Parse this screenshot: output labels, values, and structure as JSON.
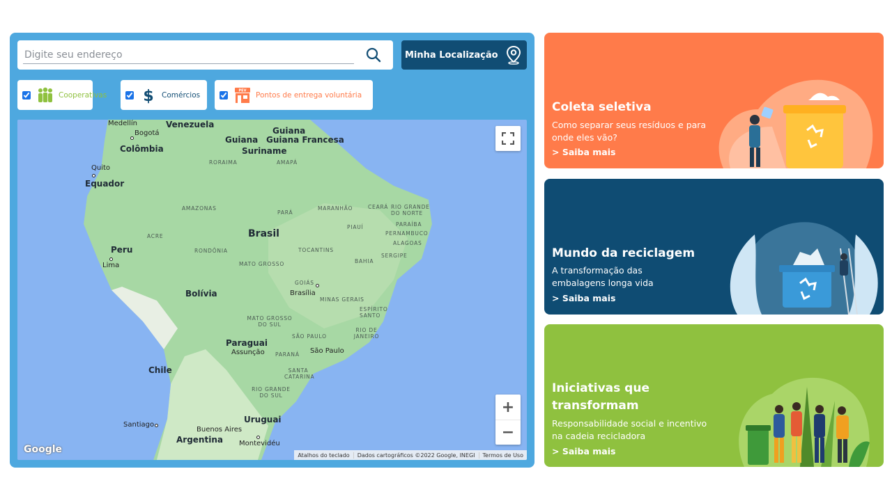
{
  "search": {
    "placeholder": "Digite seu endereço"
  },
  "location_button": {
    "label": "Minha Localização"
  },
  "filters": [
    {
      "label": "Cooperativas",
      "checked": true,
      "color": "#8fc13f"
    },
    {
      "label": "Comércios",
      "checked": true,
      "color": "#114d74"
    },
    {
      "label": "Pontos de entrega voluntária",
      "checked": true,
      "color": "#ff7b4a",
      "badge": "PEV"
    }
  ],
  "map": {
    "labels": {
      "medellin": "Medellín",
      "venezuela": "Venezuela",
      "bogota": "Bogotá",
      "colombia": "Colômbia",
      "guiana": "Guiana",
      "guiana_francesa": "Guiana Francesa",
      "suriname": "Suriname",
      "roraima": "RORAIMA",
      "amapa": "AMAPÁ",
      "quito": "Quito",
      "equador": "Equador",
      "amazonas": "AMAZONAS",
      "para": "PARÁ",
      "maranhao": "MARANHÃO",
      "ceara": "CEARÁ",
      "rio_grande_norte": "RIO GRANDE DO NORTE",
      "piaui": "PIAUÍ",
      "paraiba": "PARAÍBA",
      "pernambuco": "PERNAMBUCO",
      "alagoas": "ALAGOAS",
      "sergipe": "SERGIPE",
      "acre": "ACRE",
      "brasil": "Brasil",
      "rondonia": "RONDÔNIA",
      "tocantins": "TOCANTINS",
      "peru": "Peru",
      "lima": "Lima",
      "mato_grosso": "MATO GROSSO",
      "bahia": "BAHIA",
      "goias": "GOIÁS",
      "brasilia": "Brasília",
      "bolivia": "Bolívia",
      "minas_gerais": "MINAS GERAIS",
      "espirito_santo": "ESPÍRITO SANTO",
      "mato_grosso_sul": "MATO GROSSO DO SUL",
      "rio_de_janeiro": "RIO DE JANEIRO",
      "sao_paulo_state": "SÃO PAULO",
      "paraguai": "Paraguai",
      "assuncao": "Assunção",
      "parana": "PARANÁ",
      "sao_paulo": "São Paulo",
      "santa_catarina": "SANTA CATARINA",
      "chile": "Chile",
      "rio_grande_sul": "RIO GRANDE DO SUL",
      "uruguai": "Uruguai",
      "santiago": "Santiago",
      "buenos_aires": "Buenos Aires",
      "argentina": "Argentina",
      "montevideu": "Montevidéu"
    },
    "google_logo": "Google",
    "attribution": [
      "Atalhos do teclado",
      "Dados cartográficos ©2022 Google, INEGI",
      "Termos de Uso"
    ],
    "zoom_in": "+",
    "zoom_out": "−"
  },
  "cards": [
    {
      "title": "Coleta seletiva",
      "desc1": "Como separar seus resíduos e para",
      "desc2": "onde eles vão?",
      "link": "> Saiba mais",
      "color": "#ff7b4a"
    },
    {
      "title": "Mundo da reciclagem",
      "desc1": "A transformação das",
      "desc2": "embalagens longa vida",
      "link": "> Saiba mais",
      "color": "#0f4c73"
    },
    {
      "title1": "Iniciativas que",
      "title2": "transformam",
      "desc1": "Responsabilidade social e incentivo",
      "desc2": "na cadeia recicladora",
      "link": "> Saiba mais",
      "color": "#8fc13f"
    }
  ]
}
